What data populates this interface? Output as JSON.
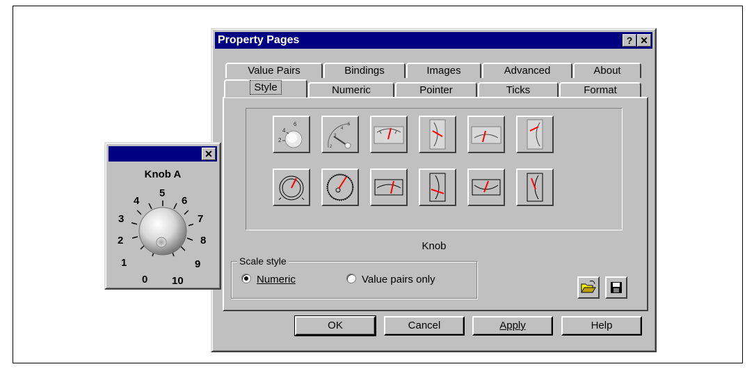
{
  "dialog": {
    "title": "Property Pages",
    "help_button": "?",
    "close_button": "✕",
    "tabs_back": [
      "Value Pairs",
      "Bindings",
      "Images",
      "Advanced",
      "About"
    ],
    "tabs_front": [
      "Style",
      "Numeric",
      "Pointer",
      "Ticks",
      "Format"
    ],
    "active_tab": "Style",
    "styles": [
      "3d-knob",
      "3d-gauge",
      "wide-meter-top",
      "vertical-meter-left",
      "wide-meter-bottom",
      "vertical-meter-right",
      "knob",
      "gauge",
      "flat-meter-top",
      "flat-meter-left",
      "flat-meter-bottom",
      "flat-meter-right"
    ],
    "selected_style_label": "Knob",
    "scale_style": {
      "legend": "Scale style",
      "options": [
        {
          "label": "Numeric",
          "selected": true
        },
        {
          "label": "Value pairs only",
          "selected": false
        }
      ]
    },
    "buttons": {
      "ok": "OK",
      "cancel": "Cancel",
      "apply": "Apply",
      "help": "Help"
    }
  },
  "knob_window": {
    "close_button": "✕",
    "caption": "Knob A",
    "scale": [
      "0",
      "1",
      "2",
      "3",
      "4",
      "5",
      "6",
      "7",
      "8",
      "9",
      "10"
    ]
  },
  "colors": {
    "titlebar": "#000080",
    "face": "#c0c0c0",
    "needle": "#ff0000"
  }
}
